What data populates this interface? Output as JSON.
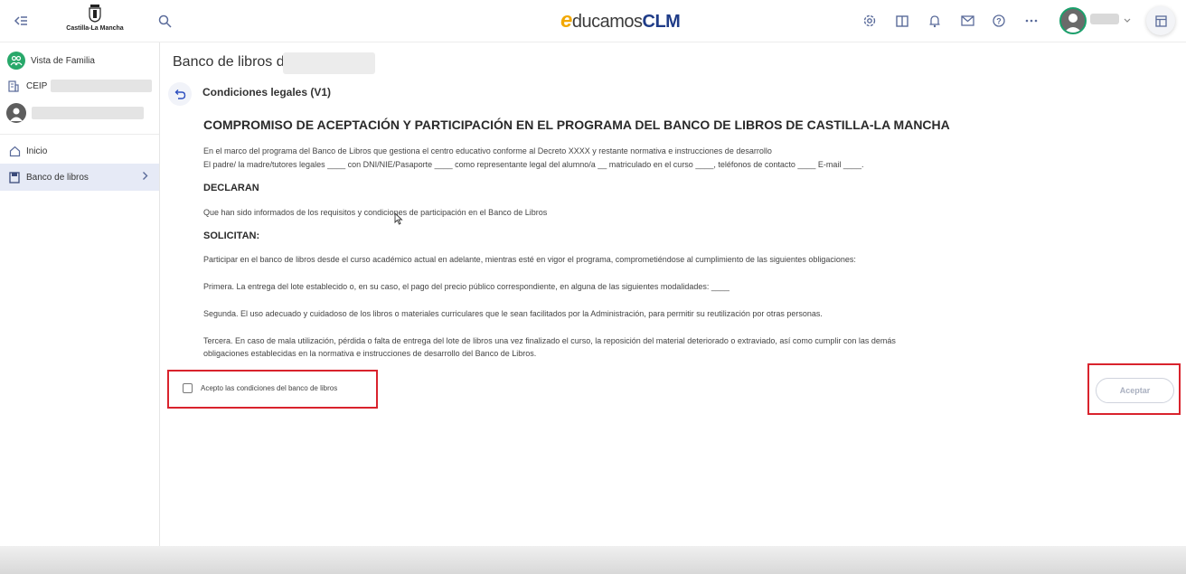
{
  "header": {
    "jccm_logo_text": "Castilla-La Mancha",
    "brand_e": "e",
    "brand_duc": "ducamos",
    "brand_clm": "CLM",
    "icons": [
      "collapse-menu-icon",
      "search-icon",
      "settings-icon",
      "book-icon",
      "bell-icon",
      "mail-icon",
      "help-icon",
      "more-icon",
      "chevron-down-icon",
      "layout-icon"
    ]
  },
  "sidebar": {
    "family_view": "Vista de Familia",
    "school_prefix": "CEIP",
    "nav": [
      {
        "label": "Inicio"
      },
      {
        "label": "Banco de libros"
      }
    ]
  },
  "main": {
    "page_title": "Banco de libros de",
    "section_title": "Condiciones legales (V1)",
    "doc_title": "COMPROMISO DE ACEPTACIÓN Y PARTICIPACIÓN EN EL PROGRAMA DEL BANCO DE LIBROS DE CASTILLA-LA MANCHA",
    "intro_1": "En el marco del programa del Banco de Libros que gestiona el centro educativo conforme al Decreto XXXX y restante normativa e instrucciones de desarrollo",
    "intro_2": "El padre/ la madre/tutores legales ____ con DNI/NIE/Pasaporte ____ como representante legal del alumno/a __ matriculado en el curso ____, teléfonos de contacto ____ E-mail ____.",
    "declaran_heading": "DECLARAN",
    "declaran_text": "Que han sido informados de los requisitos y condiciones de participación en el Banco de Libros",
    "solicitan_heading": "SOLICITAN:",
    "solicitan_text": "Participar en el banco de libros desde el curso académico actual en adelante, mientras esté en vigor el programa, comprometiéndose al cumplimiento de las siguientes obligaciones:",
    "primera": "Primera. La entrega del lote establecido o, en su caso, el pago del precio público correspondiente, en alguna de las siguientes modalidades: ____",
    "segunda": "Segunda. El uso adecuado y cuidadoso de los libros o materiales curriculares que le sean facilitados por la Administración, para permitir su reutilización por otras personas.",
    "tercera_1": "Tercera. En caso de mala utilización, pérdida o falta de entrega del lote de libros una vez finalizado el curso, la reposición del material deteriorado o extraviado, así como cumplir con las demás",
    "tercera_2": "obligaciones establecidas en la normativa e instrucciones de desarrollo del Banco de Libros.",
    "checkbox_label": "Acepto las condiciones del banco de libros",
    "checkbox_checked": false,
    "accept_button": "Aceptar",
    "highlight_color": "#d9232d"
  }
}
